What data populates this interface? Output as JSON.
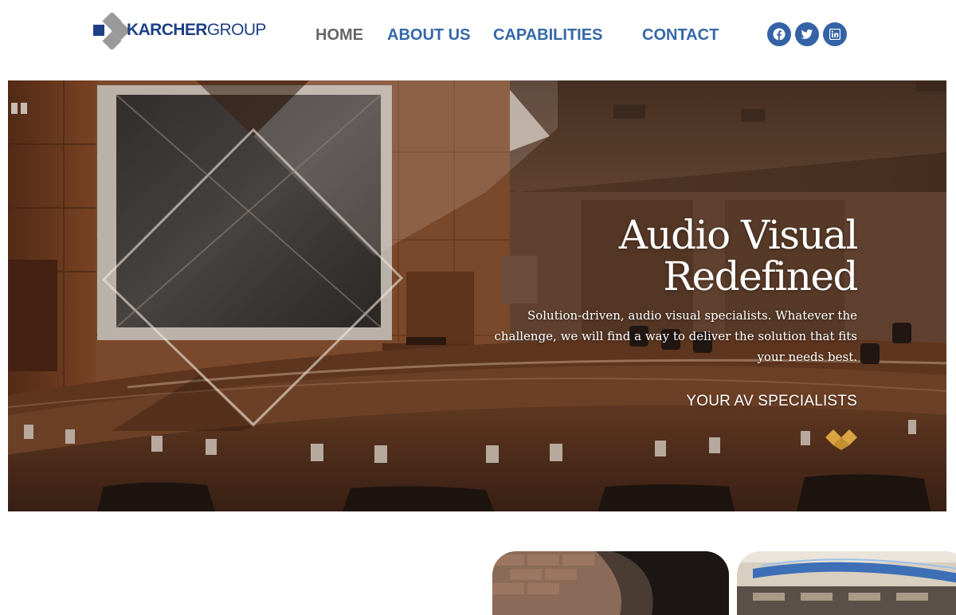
{
  "brand": {
    "name_bold": "KARCHER",
    "name_light": "GROUP",
    "primary_color": "#1f3f86",
    "accent_color": "#3567a8",
    "mark_gray": "#9a9a9a"
  },
  "nav": {
    "items": [
      {
        "label": "HOME",
        "active": true
      },
      {
        "label": "ABOUT US",
        "active": false
      },
      {
        "label": "CAPABILITIES",
        "active": false
      },
      {
        "label": "CONTACT",
        "active": false
      }
    ]
  },
  "social": [
    {
      "icon": "facebook-icon"
    },
    {
      "icon": "twitter-icon"
    },
    {
      "icon": "linkedin-icon"
    }
  ],
  "hero": {
    "title_line1": "Audio Visual",
    "title_line2": "Redefined",
    "description": "Solution-driven, audio visual specialists. Whatever the challenge, we will find a way to deliver the solution that fits your needs best.",
    "tagline": "YOUR AV SPECIALISTS",
    "accent_mark_color": "#d9a441",
    "background_subject": "lecture-hall-photo"
  },
  "cards": [
    {
      "image": "brick-wall-photo"
    },
    {
      "image": "network-cables-photo"
    }
  ]
}
